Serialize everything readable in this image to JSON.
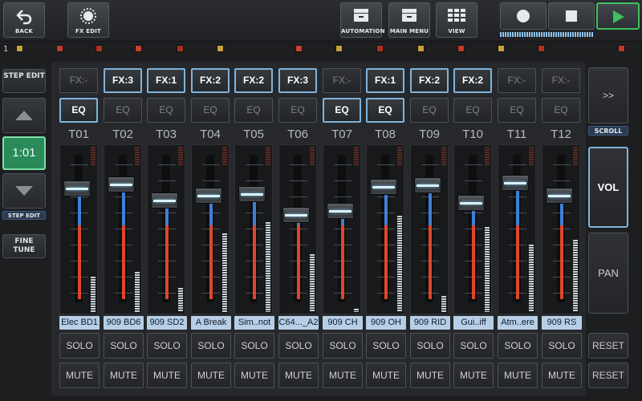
{
  "topbar": {
    "back_label": "BACK",
    "fx_edit_label": "FX EDIT",
    "automation_label": "AUTOMATION",
    "main_menu_label": "MAIN MENU",
    "view_label": "VIEW",
    "record_icon": "record-icon",
    "stop_icon": "stop-icon",
    "play_icon": "play-icon"
  },
  "clip_row": {
    "number": "1",
    "colors": [
      "#c8a23a",
      "#c0392b",
      "#b03020",
      "#c84030",
      "#a83020",
      "#c8a23a",
      "#d04030",
      "#c8a23a",
      "#b03020",
      "#c8a23a",
      "#c0392b",
      "#c8a23a",
      "#b03020",
      "#c0392b"
    ]
  },
  "left": {
    "step_edit_label": "STEP EDIT",
    "position": "1:01",
    "step_edit_caption": "STEP EDIT",
    "fine_tune_label": "FINE TUNE"
  },
  "right": {
    "scroll_label": ">>",
    "scroll_caption": "SCROLL",
    "vol_label": "VOL",
    "pan_label": "PAN",
    "reset_label": "RESET"
  },
  "colors": {
    "accent": "#7fb4dd",
    "name_bg": "#b7cfe6",
    "meter_blue": "#3f7fd9",
    "meter_red": "#e0452a",
    "play_green": "#3fbf5f",
    "position_bg": "#2a8a5a"
  },
  "channels": [
    {
      "title": "T01",
      "fx": "FX:-",
      "fx_on": false,
      "eq": "EQ",
      "eq_on": true,
      "name": "Elec BD1",
      "solo": "SOLO",
      "mute": "MUTE",
      "volume": 0.88,
      "vu": 0.22
    },
    {
      "title": "T02",
      "fx": "FX:3",
      "fx_on": true,
      "eq": "EQ",
      "eq_on": false,
      "name": "909 BD6",
      "solo": "SOLO",
      "mute": "MUTE",
      "volume": 0.91,
      "vu": 0.25
    },
    {
      "title": "T03",
      "fx": "FX:1",
      "fx_on": true,
      "eq": "EQ",
      "eq_on": false,
      "name": "909 SD2",
      "solo": "SOLO",
      "mute": "MUTE",
      "volume": 0.8,
      "vu": 0.15
    },
    {
      "title": "T04",
      "fx": "FX:2",
      "fx_on": true,
      "eq": "EQ",
      "eq_on": false,
      "name": "A Break",
      "solo": "SOLO",
      "mute": "MUTE",
      "volume": 0.83,
      "vu": 0.49
    },
    {
      "title": "T05",
      "fx": "FX:2",
      "fx_on": true,
      "eq": "EQ",
      "eq_on": false,
      "name": "Sim..not",
      "solo": "SOLO",
      "mute": "MUTE",
      "volume": 0.84,
      "vu": 0.56
    },
    {
      "title": "T06",
      "fx": "FX:3",
      "fx_on": true,
      "eq": "EQ",
      "eq_on": false,
      "name": "C64..._A2",
      "solo": "SOLO",
      "mute": "MUTE",
      "volume": 0.7,
      "vu": 0.36
    },
    {
      "title": "T07",
      "fx": "FX:-",
      "fx_on": false,
      "eq": "EQ",
      "eq_on": true,
      "name": "909 CH",
      "solo": "SOLO",
      "mute": "MUTE",
      "volume": 0.73,
      "vu": 0.02
    },
    {
      "title": "T08",
      "fx": "FX:1",
      "fx_on": true,
      "eq": "EQ",
      "eq_on": true,
      "name": "909 OH",
      "solo": "SOLO",
      "mute": "MUTE",
      "volume": 0.89,
      "vu": 0.6
    },
    {
      "title": "T09",
      "fx": "FX:2",
      "fx_on": true,
      "eq": "EQ",
      "eq_on": false,
      "name": "909 RID",
      "solo": "SOLO",
      "mute": "MUTE",
      "volume": 0.9,
      "vu": 0.1
    },
    {
      "title": "T10",
      "fx": "FX:2",
      "fx_on": true,
      "eq": "EQ",
      "eq_on": false,
      "name": "Gui..iff",
      "solo": "SOLO",
      "mute": "MUTE",
      "volume": 0.78,
      "vu": 0.53
    },
    {
      "title": "T11",
      "fx": "FX:-",
      "fx_on": false,
      "eq": "EQ",
      "eq_on": false,
      "name": "Atm..ere",
      "solo": "SOLO",
      "mute": "MUTE",
      "volume": 0.92,
      "vu": 0.42
    },
    {
      "title": "T12",
      "fx": "FX:-",
      "fx_on": false,
      "eq": "EQ",
      "eq_on": false,
      "name": "909 RS",
      "solo": "SOLO",
      "mute": "MUTE",
      "volume": 0.83,
      "vu": 0.45
    }
  ]
}
